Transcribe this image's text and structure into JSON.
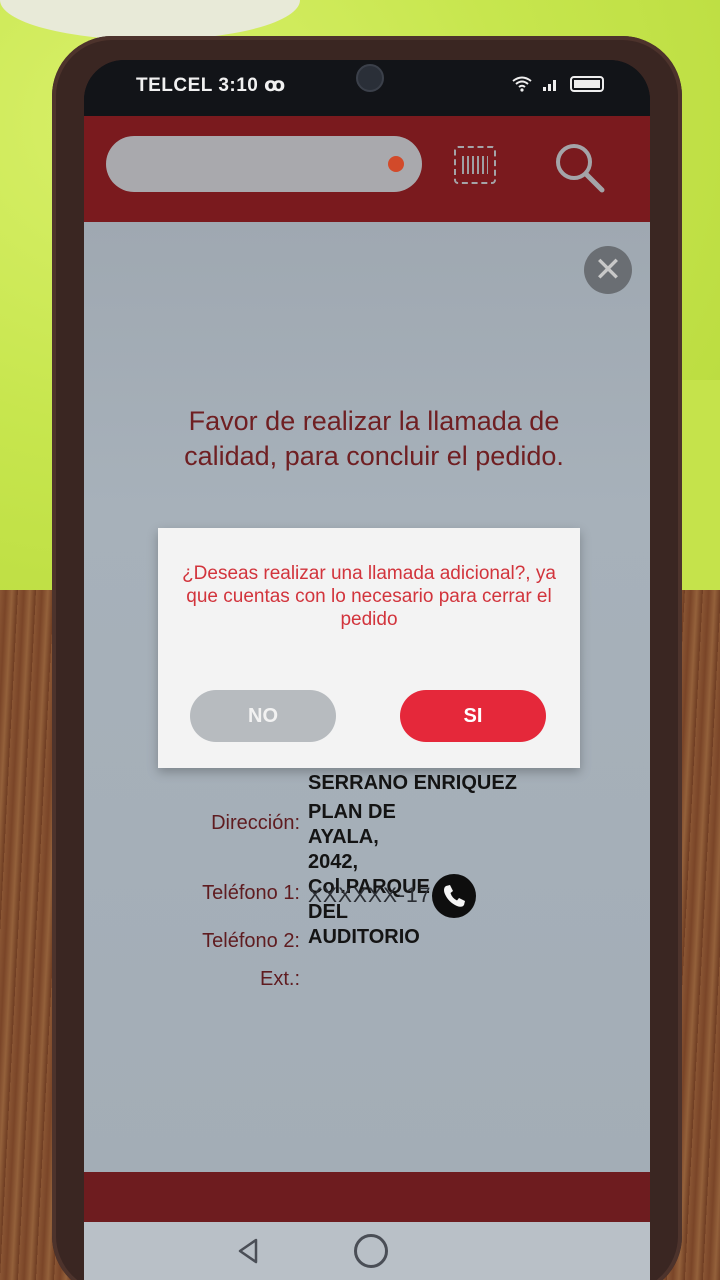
{
  "status_bar": {
    "carrier_time": "TELCEL 3:10 ꝏ"
  },
  "header": {
    "search_placeholder": "",
    "scan_icon": "barcode-scan-icon",
    "search_icon": "magnifier-icon"
  },
  "content": {
    "close_symbol": "✕",
    "notice": "Favor de realizar la llamada de calidad, para concluir el pedido.",
    "customer_name": "SERRANO ENRIQUEZ",
    "address_label": "Dirección:",
    "address_lines": [
      "PLAN DE AYALA, 2042,",
      "Col.PARQUE DEL",
      "AUDITORIO"
    ],
    "phone1_label": "Teléfono 1:",
    "phone1_value": "XXXXXX-17",
    "phone2_label": "Teléfono 2:",
    "ext_label": "Ext.:"
  },
  "dialog": {
    "message": "¿Deseas realizar una llamada adicional?, ya que cuentas con lo necesario para cerrar el pedido",
    "no_label": "NO",
    "si_label": "SI"
  },
  "colors": {
    "brand_red": "#7a1a1e",
    "accent_red": "#e5283a",
    "dialog_text": "#d2343c"
  }
}
